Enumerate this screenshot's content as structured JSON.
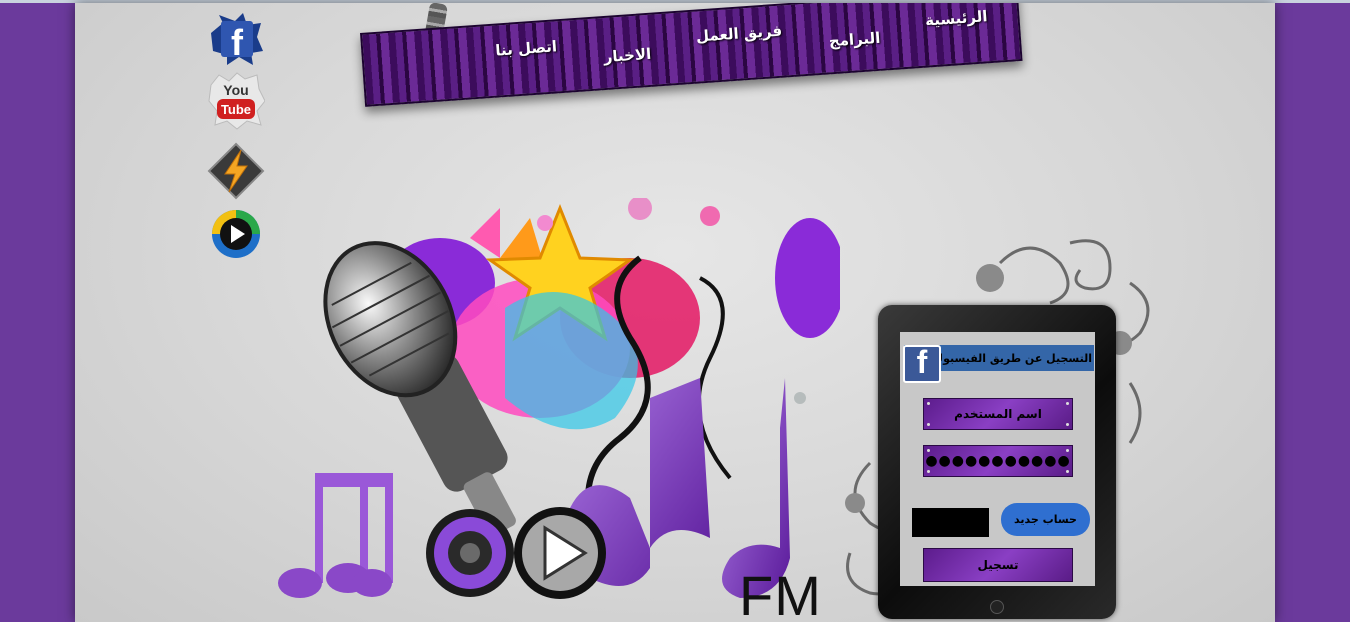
{
  "nav": {
    "items": [
      {
        "label": "الرئيسية"
      },
      {
        "label": "البرامج"
      },
      {
        "label": "فريق العمل"
      },
      {
        "label": "الاخبار"
      },
      {
        "label": "اتصل بنا"
      }
    ]
  },
  "social": {
    "facebook": {
      "letter": "f"
    },
    "youtube": {
      "top": "You",
      "bottom": "Tube"
    }
  },
  "logo": {
    "text": "FM"
  },
  "login": {
    "facebook_label": "التسجيل عن طريق الفيسبوك",
    "facebook_icon_letter": "f",
    "username_placeholder": "اسم المستخدم",
    "password_value": "●●●●●●●●●●●",
    "new_account_label": "حساب جديد",
    "register_label": "تسجيل"
  },
  "colors": {
    "page_background": "#6b3a9c",
    "nav_wood": "#4a1470",
    "accent_purple": "#8a3fc4",
    "facebook_blue": "#3b5998",
    "new_account_blue": "#2f6fd0"
  }
}
